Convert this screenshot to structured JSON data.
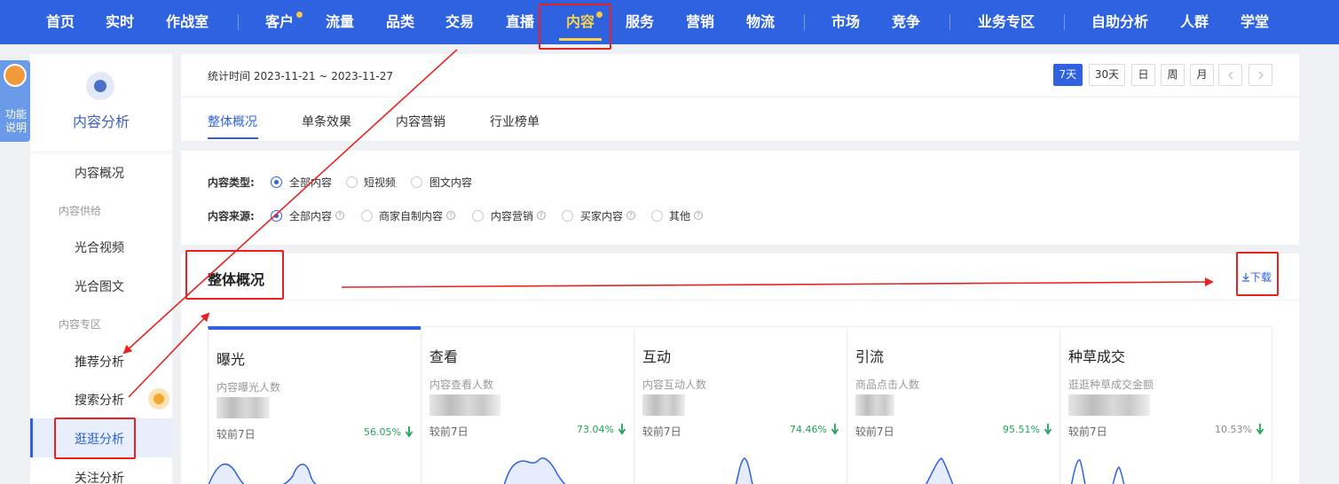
{
  "topnav": {
    "items": [
      "首页",
      "实时",
      "作战室",
      "客户",
      "流量",
      "品类",
      "交易",
      "直播",
      "内容",
      "服务",
      "营销",
      "物流",
      "市场",
      "竞争",
      "业务专区",
      "自助分析",
      "人群",
      "学堂"
    ],
    "active": "内容"
  },
  "help": {
    "label": "功能说明"
  },
  "sidebar": {
    "title": "内容分析",
    "items": {
      "overview": "内容概况",
      "group_supply": "内容供给",
      "video": "光合视频",
      "article": "光合图文",
      "group_zone": "内容专区",
      "recommend": "推荐分析",
      "search": "搜索分析",
      "browse": "逛逛分析",
      "follow": "关注分析"
    }
  },
  "header": {
    "date_range": "统计时间 2023-11-21 ~ 2023-11-27",
    "range_buttons": [
      "7天",
      "30天",
      "日",
      "周",
      "月"
    ],
    "active_range": "7天",
    "tabs": [
      "整体概况",
      "单条效果",
      "内容营销",
      "行业榜单"
    ]
  },
  "filters": {
    "type_label": "内容类型:",
    "type_options": [
      "全部内容",
      "短视频",
      "图文内容"
    ],
    "source_label": "内容来源:",
    "source_options": [
      "全部内容",
      "商家自制内容",
      "内容营销",
      "买家内容",
      "其他"
    ]
  },
  "overview": {
    "title": "整体概况",
    "download": "下载",
    "metrics": [
      {
        "name": "曝光",
        "sub": "内容曝光人数",
        "compare": "较前7日",
        "change": "56.05%"
      },
      {
        "name": "查看",
        "sub": "内容查看人数",
        "compare": "较前7日",
        "change": "73.04%"
      },
      {
        "name": "互动",
        "sub": "内容互动人数",
        "compare": "较前7日",
        "change": "74.46%"
      },
      {
        "name": "引流",
        "sub": "商品点击人数",
        "compare": "较前7日",
        "change": "95.51%"
      },
      {
        "name": "种草成交",
        "sub": "逛逛种草成交金额",
        "compare": "较前7日",
        "change": "10.53%"
      }
    ]
  },
  "colors": {
    "brand": "#2e62e0",
    "highlight": "#f7d44a",
    "annotation": "#e8231f",
    "down": "#21a559"
  }
}
